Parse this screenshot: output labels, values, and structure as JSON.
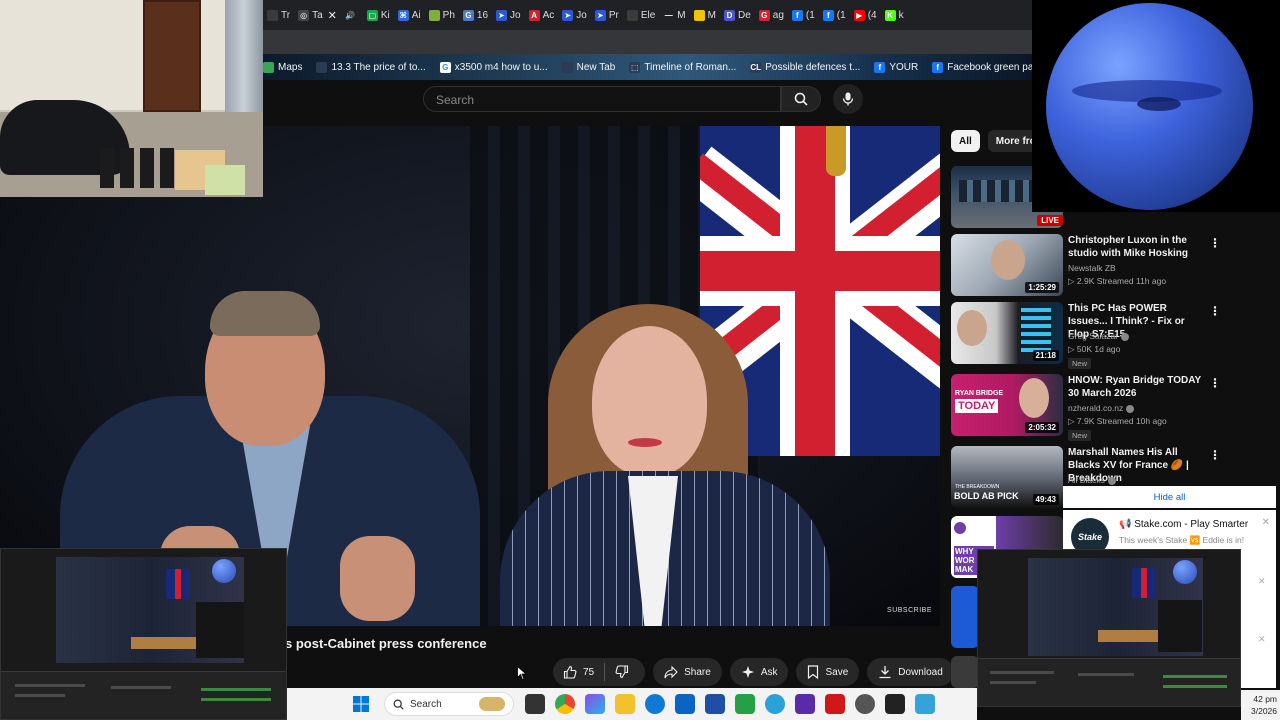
{
  "browser": {
    "tabs": [
      {
        "label": "Tr",
        "color": "#3a3a3a",
        "glyph": ""
      },
      {
        "label": "Ta",
        "color": "#444444",
        "glyph": "◎"
      },
      {
        "label": "",
        "color": "#202124",
        "glyph": "🔊"
      },
      {
        "label": "Ki",
        "color": "#1da64a",
        "glyph": "▢"
      },
      {
        "label": "Ai",
        "color": "#2a6bd4",
        "glyph": "⌘"
      },
      {
        "label": "Ph",
        "color": "#7fb13a",
        "glyph": ""
      },
      {
        "label": "16",
        "color": "#4a7ac9",
        "glyph": "G"
      },
      {
        "label": "Jo",
        "color": "#2a5bd4",
        "glyph": "➤"
      },
      {
        "label": "Ac",
        "color": "#d2232a",
        "glyph": "A"
      },
      {
        "label": "Jo",
        "color": "#2a5bd4",
        "glyph": "➤"
      },
      {
        "label": "Pr",
        "color": "#2a5bd4",
        "glyph": "➤"
      },
      {
        "label": "Ele",
        "color": "#3b3b3b",
        "glyph": ""
      },
      {
        "label": "M",
        "color": "#202124",
        "glyph": "—"
      },
      {
        "label": "M",
        "color": "#f4c20d",
        "glyph": ""
      },
      {
        "label": "De",
        "color": "#4a56c8",
        "glyph": "D"
      },
      {
        "label": "ag",
        "color": "#d2232a",
        "glyph": "G"
      },
      {
        "label": "(1",
        "color": "#1877f2",
        "glyph": "f"
      },
      {
        "label": "(1",
        "color": "#1877f2",
        "glyph": "f"
      },
      {
        "label": "(4",
        "color": "#ff0000",
        "glyph": "▶"
      },
      {
        "label": "k",
        "color": "#53fc18",
        "glyph": "K"
      }
    ],
    "bookmarks": [
      {
        "label": "Maps",
        "color": "#34a853",
        "glyph": ""
      },
      {
        "label": "13.3 The price of to...",
        "color": "#2a3b55",
        "glyph": ""
      },
      {
        "label": "x3500 m4 how to u...",
        "color": "#ffffff",
        "glyph": "G"
      },
      {
        "label": "New Tab",
        "color": "#2a3b55",
        "glyph": ""
      },
      {
        "label": "Timeline of Roman...",
        "color": "#2a3b55",
        "glyph": "⬚"
      },
      {
        "label": "Possible defences t...",
        "color": "#2a3b55",
        "glyph": "CL"
      },
      {
        "label": "YOUR",
        "color": "#1877f2",
        "glyph": "f"
      },
      {
        "label": "Facebook green party",
        "color": "#1877f2",
        "glyph": "f"
      }
    ]
  },
  "youtube": {
    "search": {
      "placeholder": "Search"
    },
    "video": {
      "title": "s post-Cabinet press conference",
      "watermark": "SUBSCRIBE"
    },
    "actions": {
      "likes": "75",
      "share": "Share",
      "ask": "Ask",
      "save": "Save",
      "download": "Download"
    },
    "chips": [
      "All",
      "More fron"
    ],
    "recommendations": [
      {
        "title": "Christopher Luxon in the studio with Mike Hosking",
        "channel": "Newstalk ZB",
        "meta": "▷ 2.9K  Streamed 11h ago",
        "duration": "1:25:29",
        "new": ""
      },
      {
        "title": "This PC Has POWER Issues... I Think? - Fix or Flop S7:E15",
        "channel": "Greg Salazar",
        "meta": "▷ 50K  1d ago",
        "duration": "21:18",
        "new": "New"
      },
      {
        "title": "HNOW: Ryan Bridge TODAY 30 March 2026",
        "channel": "nzherald.co.nz",
        "meta": "▷ 7.9K  Streamed 10h ago",
        "duration": "2:05:32",
        "new": "New"
      },
      {
        "title": "Marshall Names His All Blacks XV for France 🏉 | Breakdown",
        "channel": "All Blacks",
        "meta": "",
        "duration": "49:43",
        "new": ""
      }
    ],
    "live_badge": "LIVE",
    "thumb_texts": {
      "ryan": "RYAN BRIDGE",
      "today": "TODAY",
      "breakdown": "THE BREAKDOWN",
      "bold": "BOLD AB PICK",
      "why": "WHY WOR MAK"
    }
  },
  "notification": {
    "hide_all": "Hide all",
    "ad_logo": "Stake",
    "ad_title": "📢 Stake.com - Play Smarter",
    "ad_text": "This week's Stake 🆚 Eddie is in!"
  },
  "taskbar": {
    "search_placeholder": "Search",
    "clock_time": "42 pm",
    "clock_date": "3/2026"
  },
  "colors": {
    "accent_red": "#cc0000",
    "link_blue": "#065fd4",
    "yt_bg": "#0f0f0f"
  }
}
